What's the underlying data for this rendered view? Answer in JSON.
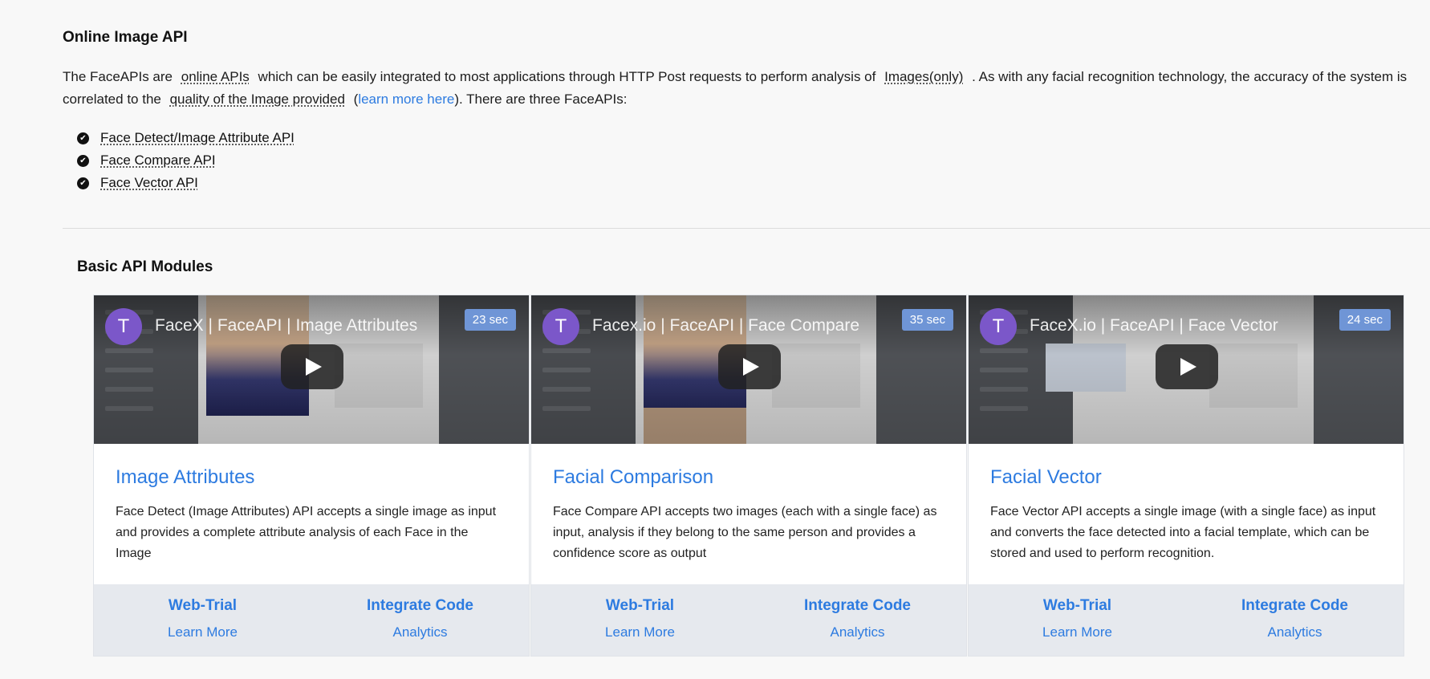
{
  "intro": {
    "title": "Online Image API",
    "p1": "The FaceAPIs are",
    "term1": "online APIs",
    "p2": "which can be easily integrated to most applications through HTTP Post requests to perform analysis of",
    "term2": "Images(only)",
    "p3": ". As with any facial recognition technology, the accuracy of the system is correlated to the",
    "term3": "quality of the Image provided",
    "p4": "(",
    "link": "learn more here",
    "p5": "). There are three FaceAPIs:",
    "apis": [
      "Face Detect/Image Attribute API",
      "Face Compare API",
      "Face Vector API"
    ]
  },
  "section": {
    "title": "Basic API Modules"
  },
  "modules": [
    {
      "video": {
        "avatar": "T",
        "title": "FaceX | FaceAPI | Image Attributes",
        "duration": "23 sec"
      },
      "title": "Image Attributes",
      "desc": "Face Detect (Image Attributes) API accepts a single image as input and provides a complete attribute analysis of each Face in the Image",
      "left_main": "Web-Trial",
      "left_sub": "Learn More",
      "right_main": "Integrate Code",
      "right_sub": "Analytics"
    },
    {
      "video": {
        "avatar": "T",
        "title": "Facex.io | FaceAPI | Face Compare",
        "duration": "35 sec"
      },
      "title": "Facial Comparison",
      "desc": "Face Compare API accepts two images (each with a single face) as input, analysis if they belong to the same person and provides a confidence score as output",
      "left_main": "Web-Trial",
      "left_sub": "Learn More",
      "right_main": "Integrate Code",
      "right_sub": "Analytics"
    },
    {
      "video": {
        "avatar": "T",
        "title": "FaceX.io | FaceAPI | Face Vector",
        "duration": "24 sec"
      },
      "title": "Facial Vector",
      "desc": "Face Vector API accepts a single image (with a single face) as input and converts the face detected into a facial template, which can be stored and used to perform recognition.",
      "left_main": "Web-Trial",
      "left_sub": "Learn More",
      "right_main": "Integrate Code",
      "right_sub": "Analytics"
    }
  ],
  "colors": {
    "link": "#2d7be0",
    "footer": "#e6e9ee",
    "avatar": "#7b57c9",
    "duration_badge": "#6f95d6"
  },
  "icons": {
    "check": "check-circle-icon",
    "play": "play-icon"
  }
}
